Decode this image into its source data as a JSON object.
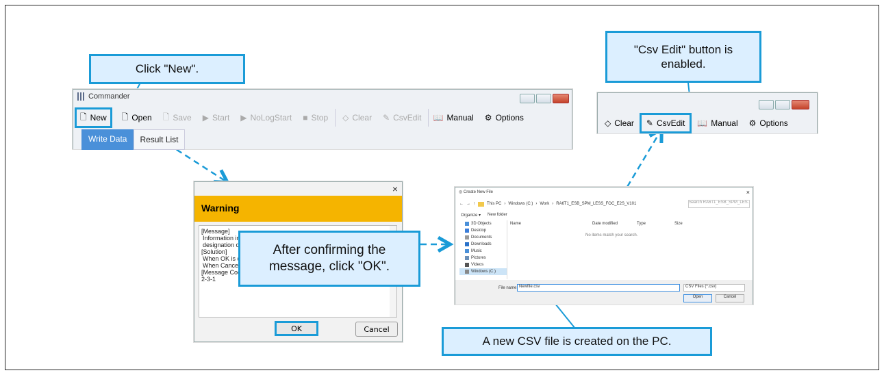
{
  "callouts": {
    "click_new": "Click \"New\".",
    "csv_enabled": "\"Csv Edit\" button is enabled.",
    "confirm_ok": "After confirming the message, click \"OK\".",
    "csv_created": "A new CSV file is created on the PC."
  },
  "commander": {
    "title": "Commander",
    "toolbar": {
      "new": "New",
      "open": "Open",
      "save": "Save",
      "start": "Start",
      "nologstart": "NoLogStart",
      "stop": "Stop",
      "clear": "Clear",
      "csvedit": "CsvEdit",
      "manual": "Manual",
      "options": "Options"
    },
    "tabs": [
      "Write Data",
      "Result List"
    ]
  },
  "toolbar2": {
    "clear": "Clear",
    "csvedit": "CsvEdit",
    "manual": "Manual",
    "options": "Options"
  },
  "warning": {
    "title": "Warning",
    "lines": [
      "[Message]",
      "Information in th",
      "designation of th",
      "[Solution]",
      "When OK is chos",
      "When Cancel is",
      "[Message Code]",
      "2-3-1"
    ],
    "ok": "OK",
    "cancel": "Cancel"
  },
  "filedlg": {
    "title": "Create New File",
    "path": [
      "This PC",
      "Windows (C:)",
      "Work",
      "RA6T1_ESB_SPM_LESS_FOC_E2S_V101"
    ],
    "search_placeholder": "Search RA6T1_ESB_SPM_LES...",
    "organize": "Organize ▾",
    "new_folder": "New folder",
    "nav_items": [
      "3D Objects",
      "Desktop",
      "Documents",
      "Downloads",
      "Music",
      "Pictures",
      "Videos",
      "Windows (C:)"
    ],
    "columns": [
      "Name",
      "Date modified",
      "Type",
      "Size"
    ],
    "empty_msg": "No items match your search.",
    "filename_label": "File name:",
    "filename": "Newfile.csv",
    "filetype": "CSV Files (*.csv)",
    "open": "Open",
    "cancel": "Cancel"
  },
  "colors": {
    "accent": "#1a9bd7",
    "callout_fill": "#dcefff",
    "warning_bar": "#f5b400",
    "tab_active": "#4a90d9"
  }
}
